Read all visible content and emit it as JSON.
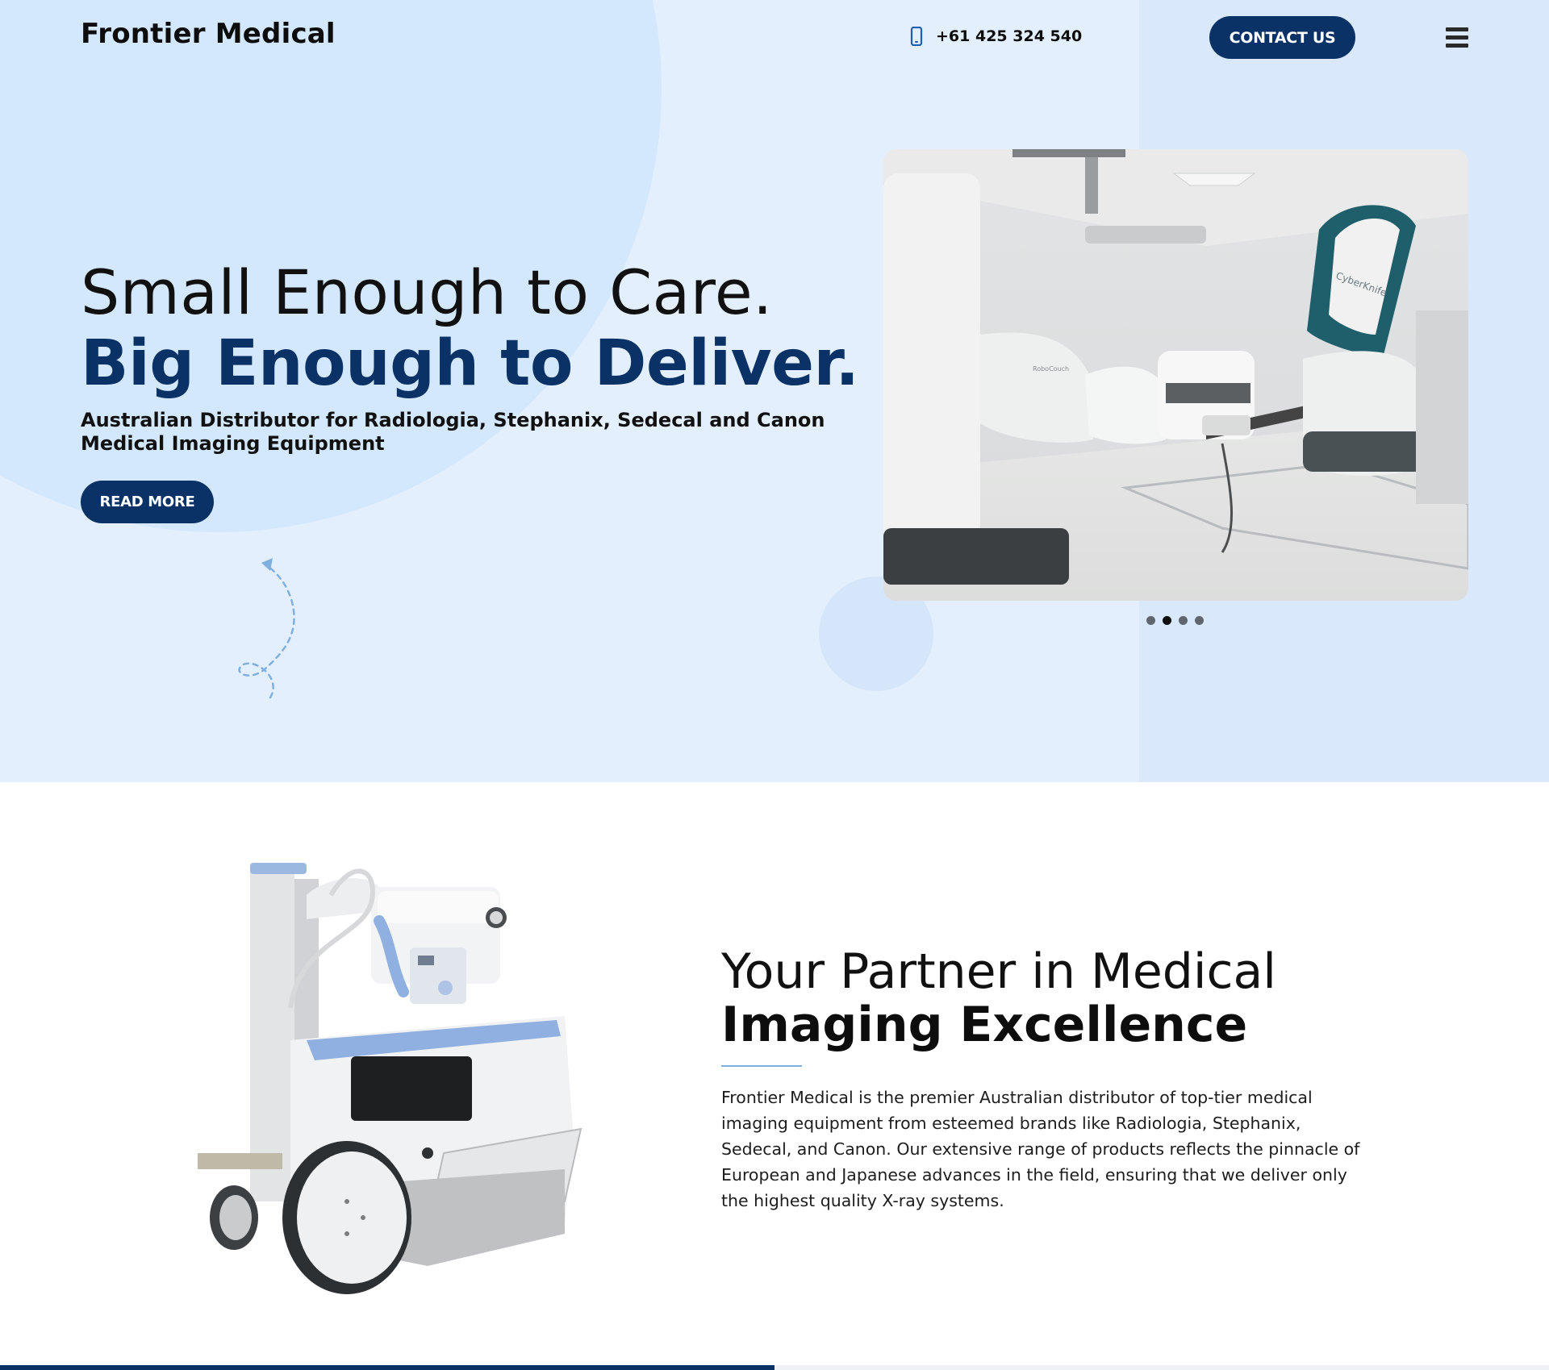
{
  "header": {
    "brand": "Frontier Medical",
    "phone_icon": "mobile-phone-icon",
    "phone": "+61 425 324 540",
    "contact_label": "CONTACT US",
    "menu_icon": "hamburger-menu-icon"
  },
  "hero": {
    "line1": "Small Enough to Care.",
    "line2": "Big Enough to Deliver.",
    "subtitle": "Australian Distributor for Radiologia, Stephanix, Sedecal and Canon Medical Imaging Equipment",
    "read_more_label": "READ MORE",
    "slide_image": "CyberKnife radiotherapy treatment room photo",
    "slide_image_text": [
      "CyberKnife",
      "RoboCouch"
    ],
    "slider": {
      "count": 4,
      "active_index": 1
    }
  },
  "about": {
    "heading_light": "Your Partner in Medical",
    "heading_bold": "Imaging Excellence",
    "body": "Frontier Medical is the premier Australian distributor of top-tier medical imaging equipment from esteemed brands like Radiologia, Stephanix, Sedecal, and Canon. Our extensive range of products reflects the pinnacle of European and Japanese advances in the field, ensuring that we deliver only the highest quality X-ray systems.",
    "image": "mobile x-ray unit illustration"
  },
  "colors": {
    "brand_navy": "#0b3266",
    "hero_bg": "#e4effd",
    "accent_rule": "#7faedf"
  }
}
